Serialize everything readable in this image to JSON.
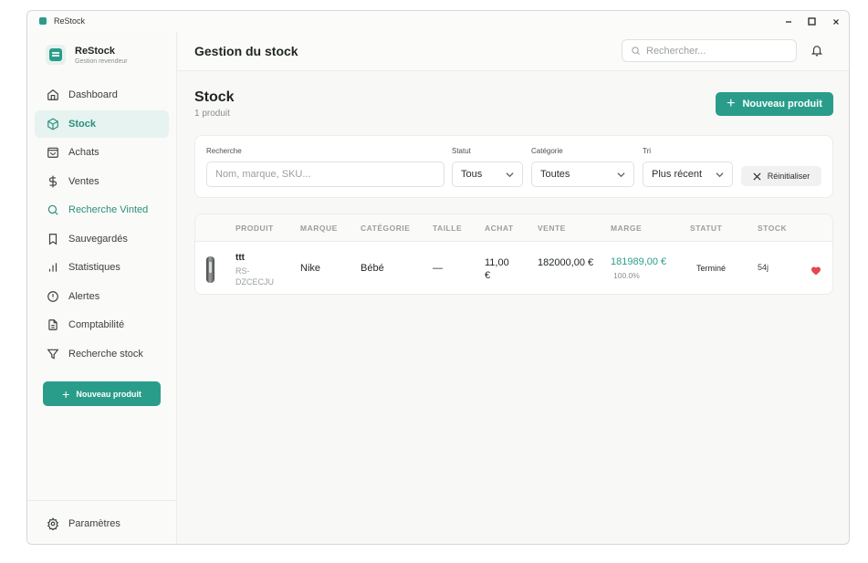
{
  "window": {
    "title": "ReStock"
  },
  "brand": {
    "name": "ReStock",
    "subtitle": "Gestion revendeur"
  },
  "sidebar": {
    "items": [
      {
        "label": "Dashboard",
        "icon": "home-icon",
        "active": false
      },
      {
        "label": "Stock",
        "icon": "box-icon",
        "active": true
      },
      {
        "label": "Achats",
        "icon": "shopping-bag-icon",
        "active": false
      },
      {
        "label": "Ventes",
        "icon": "dollar-icon",
        "active": false
      },
      {
        "label": "Recherche Vinted",
        "icon": "search-icon",
        "active": false
      },
      {
        "label": "Sauvegardés",
        "icon": "bookmark-icon",
        "active": false
      },
      {
        "label": "Statistiques",
        "icon": "bar-chart-icon",
        "active": false
      },
      {
        "label": "Alertes",
        "icon": "alert-circle-icon",
        "active": false
      },
      {
        "label": "Comptabilité",
        "icon": "file-text-icon",
        "active": false
      },
      {
        "label": "Recherche stock",
        "icon": "filter-icon",
        "active": false
      }
    ],
    "new_product": "Nouveau produit",
    "settings": "Paramètres"
  },
  "header": {
    "title": "Gestion du stock",
    "search_placeholder": "Rechercher..."
  },
  "page": {
    "title": "Stock",
    "count": "1 produit",
    "new_product": "Nouveau produit"
  },
  "filters": {
    "search_label": "Recherche",
    "search_placeholder": "Nom, marque, SKU...",
    "status_label": "Statut",
    "status_value": "Tous",
    "category_label": "Catégorie",
    "category_value": "Toutes",
    "sort_label": "Tri",
    "sort_value": "Plus récent",
    "reset": "Réinitialiser"
  },
  "table": {
    "columns": [
      "Produit",
      "Marque",
      "Catégorie",
      "Taille",
      "Achat",
      "Vente",
      "Marge",
      "Statut",
      "Stock"
    ],
    "rows": [
      {
        "name": "ttt",
        "sku": "RS-DZCECJU",
        "brand": "Nike",
        "category": "Bébé",
        "size": "—",
        "buy": "11,00 €",
        "sell": "182000,00 €",
        "margin": "181989,00 €",
        "margin_pct": "100.0%",
        "status": "Terminé",
        "stock": "54j"
      }
    ]
  },
  "colors": {
    "accent": "#2a9d8a",
    "favorite": "#e5484d"
  }
}
